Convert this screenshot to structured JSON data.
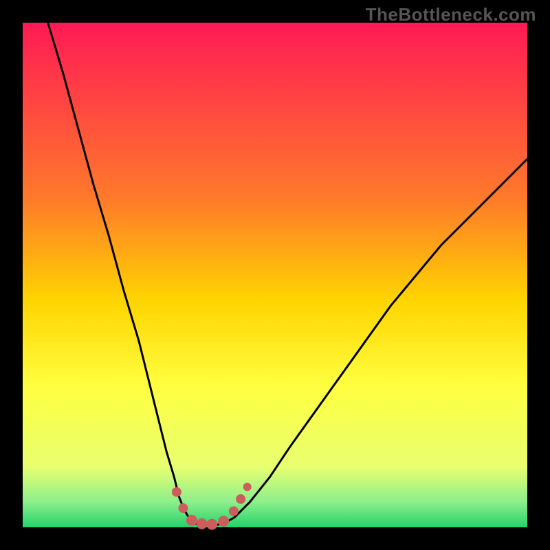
{
  "watermark": "TheBottleneck.com",
  "chart_data": {
    "type": "line",
    "title": "",
    "xlabel": "",
    "ylabel": "",
    "xlim": [
      0,
      100
    ],
    "ylim": [
      0,
      100
    ],
    "background_gradient": {
      "stops": [
        {
          "offset": 0.0,
          "color": "#ff1a55"
        },
        {
          "offset": 0.35,
          "color": "#ff7a2a"
        },
        {
          "offset": 0.55,
          "color": "#ffd400"
        },
        {
          "offset": 0.72,
          "color": "#ffff40"
        },
        {
          "offset": 0.88,
          "color": "#e8ff70"
        },
        {
          "offset": 0.95,
          "color": "#8cef8c"
        },
        {
          "offset": 1.0,
          "color": "#22d36a"
        }
      ]
    },
    "series": [
      {
        "name": "curve-left",
        "x": [
          5,
          8,
          11,
          14,
          17,
          20,
          23,
          25,
          27,
          28.5,
          30,
          31,
          32,
          33,
          34
        ],
        "y": [
          100,
          90,
          79,
          68,
          58,
          47,
          37,
          29,
          21,
          15,
          10,
          6,
          3.5,
          1.8,
          0.8
        ]
      },
      {
        "name": "curve-floor",
        "x": [
          34,
          36,
          38,
          40
        ],
        "y": [
          0.8,
          0.4,
          0.4,
          0.8
        ]
      },
      {
        "name": "curve-right",
        "x": [
          40,
          42,
          45,
          49,
          53,
          58,
          63,
          68,
          73,
          78,
          83,
          88,
          93,
          98,
          100
        ],
        "y": [
          0.8,
          2,
          5,
          10,
          16,
          23,
          30,
          37,
          44,
          50,
          56,
          61,
          66,
          71,
          73
        ]
      }
    ],
    "markers": {
      "name": "salmon-markers",
      "color": "#cd5c5c",
      "points": [
        {
          "x": 30.5,
          "y": 7.0,
          "r": 7
        },
        {
          "x": 31.8,
          "y": 3.8,
          "r": 7
        },
        {
          "x": 33.5,
          "y": 1.4,
          "r": 8
        },
        {
          "x": 35.5,
          "y": 0.7,
          "r": 8
        },
        {
          "x": 37.5,
          "y": 0.6,
          "r": 8
        },
        {
          "x": 39.8,
          "y": 1.2,
          "r": 8
        },
        {
          "x": 41.8,
          "y": 3.2,
          "r": 7
        },
        {
          "x": 43.2,
          "y": 5.6,
          "r": 7
        },
        {
          "x": 44.5,
          "y": 8.0,
          "r": 6
        }
      ]
    }
  }
}
